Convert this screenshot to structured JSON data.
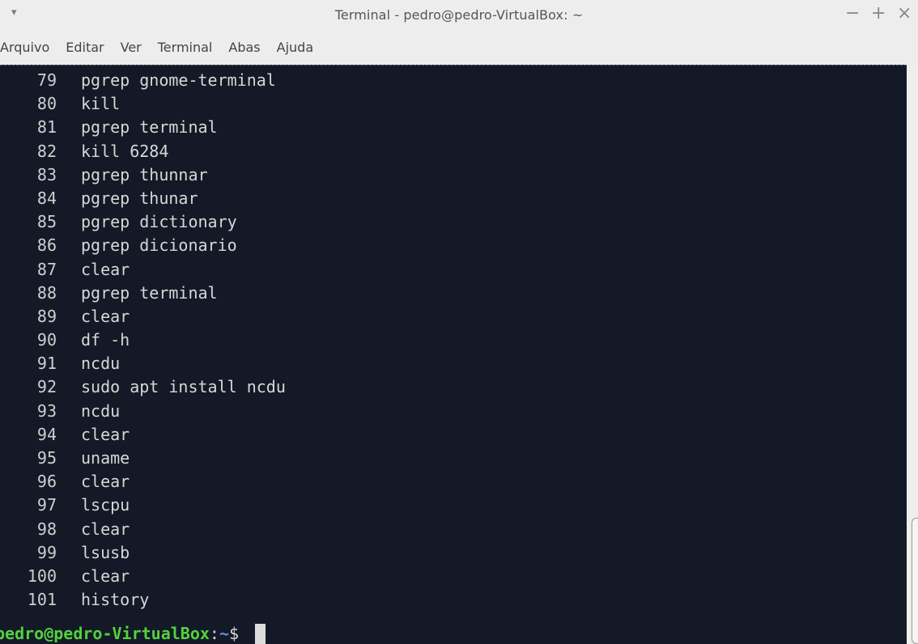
{
  "window": {
    "title": "Terminal - pedro@pedro-VirtualBox: ~",
    "menu_glyph": "▾",
    "controls": {
      "minimize": "−",
      "maximize": "+",
      "close": "×"
    }
  },
  "menubar": [
    "Arquivo",
    "Editar",
    "Ver",
    "Terminal",
    "Abas",
    "Ajuda"
  ],
  "history": [
    {
      "num": "79",
      "cmd": "pgrep gnome-terminal"
    },
    {
      "num": "80",
      "cmd": "kill"
    },
    {
      "num": "81",
      "cmd": "pgrep terminal"
    },
    {
      "num": "82",
      "cmd": "kill 6284"
    },
    {
      "num": "83",
      "cmd": "pgrep thunnar"
    },
    {
      "num": "84",
      "cmd": "pgrep thunar"
    },
    {
      "num": "85",
      "cmd": "pgrep dictionary"
    },
    {
      "num": "86",
      "cmd": "pgrep dicionario"
    },
    {
      "num": "87",
      "cmd": "clear"
    },
    {
      "num": "88",
      "cmd": "pgrep terminal"
    },
    {
      "num": "89",
      "cmd": "clear"
    },
    {
      "num": "90",
      "cmd": "df -h"
    },
    {
      "num": "91",
      "cmd": "ncdu"
    },
    {
      "num": "92",
      "cmd": "sudo apt install ncdu"
    },
    {
      "num": "93",
      "cmd": "ncdu"
    },
    {
      "num": "94",
      "cmd": "clear"
    },
    {
      "num": "95",
      "cmd": "uname"
    },
    {
      "num": "96",
      "cmd": "clear"
    },
    {
      "num": "97",
      "cmd": "lscpu"
    },
    {
      "num": "98",
      "cmd": "clear"
    },
    {
      "num": "99",
      "cmd": "lsusb"
    },
    {
      "num": "100",
      "cmd": "clear"
    },
    {
      "num": "101",
      "cmd": "history"
    }
  ],
  "prompt": {
    "user_host": "pedro@pedro-VirtualBox",
    "separator": ":",
    "path": "~",
    "symbol": "$ "
  },
  "colors": {
    "terminal_bg": "#131926",
    "prompt_user": "#52d13f",
    "prompt_path": "#5a93e0"
  }
}
